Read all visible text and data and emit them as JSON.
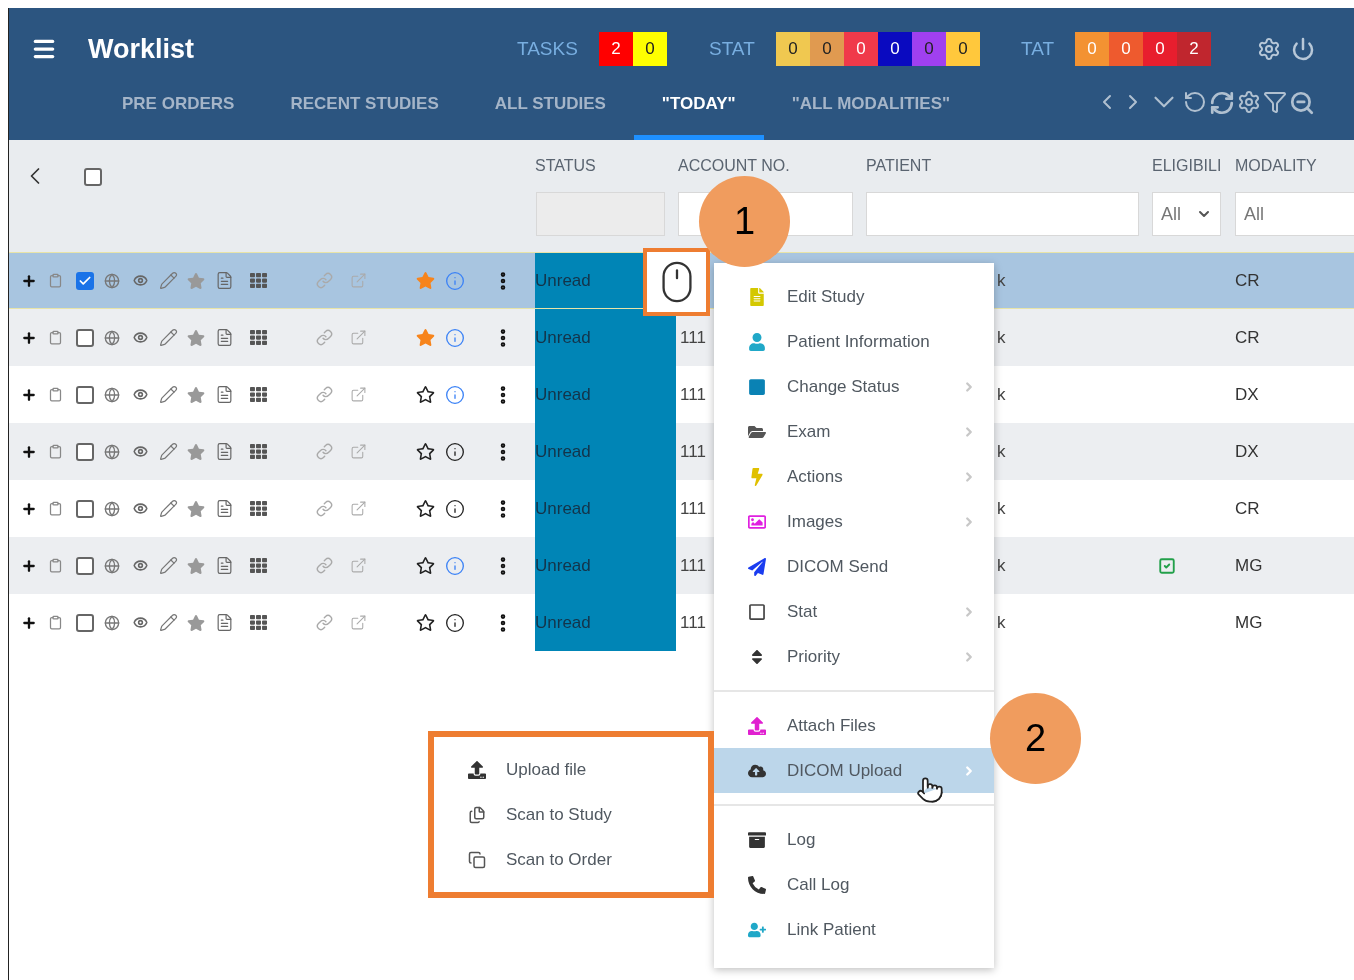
{
  "header": {
    "title": "Worklist",
    "counters": [
      {
        "label": "TASKS",
        "badges": [
          {
            "value": "2",
            "color": "#ff0000",
            "light_text": true
          },
          {
            "value": "0",
            "color": "#ffff00",
            "light_text": false
          }
        ]
      },
      {
        "label": "STAT",
        "badges": [
          {
            "value": "0",
            "color": "#f0c850",
            "light_text": false
          },
          {
            "value": "0",
            "color": "#e09a50",
            "light_text": false
          },
          {
            "value": "0",
            "color": "#f0394a",
            "light_text": true
          },
          {
            "value": "0",
            "color": "#0a0ac0",
            "light_text": true
          },
          {
            "value": "0",
            "color": "#a040f0",
            "light_text": false
          },
          {
            "value": "0",
            "color": "#ffc83c",
            "light_text": false
          }
        ]
      },
      {
        "label": "TAT",
        "badges": [
          {
            "value": "0",
            "color": "#f39232",
            "light_text": true
          },
          {
            "value": "0",
            "color": "#ee5a2e",
            "light_text": true
          },
          {
            "value": "0",
            "color": "#e81e2e",
            "light_text": true
          },
          {
            "value": "2",
            "color": "#c0262e",
            "light_text": true
          }
        ]
      }
    ],
    "tabs": [
      {
        "label": "PRE ORDERS",
        "selected": false
      },
      {
        "label": "RECENT STUDIES",
        "selected": false
      },
      {
        "label": "ALL STUDIES",
        "selected": false
      },
      {
        "label": "\"TODAY\"",
        "selected": true
      },
      {
        "label": "\"ALL MODALITIES\"",
        "selected": false
      }
    ]
  },
  "table": {
    "select_all_checked": false,
    "columns": [
      {
        "label": "STATUS",
        "kind": "readonly"
      },
      {
        "label": "ACCOUNT NO.",
        "kind": "text"
      },
      {
        "label": "PATIENT",
        "kind": "text"
      },
      {
        "label": "ELIGIBILI",
        "kind": "select",
        "value": "All"
      },
      {
        "label": "MODALITY",
        "kind": "combo",
        "placeholder": "All"
      }
    ],
    "rows": [
      {
        "selected": true,
        "checked": true,
        "starred": true,
        "info_active": true,
        "status": "Unread",
        "patient": "k",
        "eligible": false,
        "modality": "CR"
      },
      {
        "selected": false,
        "checked": false,
        "starred": true,
        "info_active": true,
        "status": "Unread",
        "account": "111",
        "patient": "k",
        "eligible": false,
        "modality": "CR"
      },
      {
        "selected": false,
        "checked": false,
        "starred": false,
        "info_active": true,
        "status": "Unread",
        "account": "111",
        "patient": "k",
        "eligible": false,
        "modality": "DX"
      },
      {
        "selected": false,
        "checked": false,
        "starred": false,
        "info_active": false,
        "status": "Unread",
        "account": "111",
        "patient": "k",
        "eligible": false,
        "modality": "DX"
      },
      {
        "selected": false,
        "checked": false,
        "starred": false,
        "info_active": false,
        "status": "Unread",
        "account": "111",
        "patient": "k",
        "eligible": false,
        "modality": "CR"
      },
      {
        "selected": false,
        "checked": false,
        "starred": false,
        "info_active": true,
        "status": "Unread",
        "account": "111",
        "patient": "k",
        "eligible": true,
        "modality": "MG"
      },
      {
        "selected": false,
        "checked": false,
        "starred": false,
        "info_active": false,
        "status": "Unread",
        "account": "111",
        "patient": "k",
        "eligible": false,
        "modality": "MG"
      }
    ]
  },
  "context_menu": {
    "groups": [
      [
        {
          "label": "Edit Study",
          "submenu": false,
          "selected": false
        },
        {
          "label": "Patient Information",
          "submenu": false,
          "selected": false
        },
        {
          "label": "Change Status",
          "submenu": true,
          "selected": false
        },
        {
          "label": "Exam",
          "submenu": true,
          "selected": false
        },
        {
          "label": "Actions",
          "submenu": true,
          "selected": false
        },
        {
          "label": "Images",
          "submenu": true,
          "selected": false
        },
        {
          "label": "DICOM Send",
          "submenu": false,
          "selected": false
        },
        {
          "label": "Stat",
          "submenu": true,
          "selected": false
        },
        {
          "label": "Priority",
          "submenu": true,
          "selected": false
        }
      ],
      [
        {
          "label": "Attach Files",
          "submenu": false,
          "selected": false
        },
        {
          "label": "DICOM Upload",
          "submenu": true,
          "selected": true
        }
      ],
      [
        {
          "label": "Log",
          "submenu": false,
          "selected": false
        },
        {
          "label": "Call Log",
          "submenu": false,
          "selected": false
        },
        {
          "label": "Link Patient",
          "submenu": false,
          "selected": false
        }
      ]
    ]
  },
  "submenu": [
    {
      "label": "Upload file"
    },
    {
      "label": "Scan to Study"
    },
    {
      "label": "Scan to Order"
    }
  ],
  "callouts": [
    {
      "label": "1"
    },
    {
      "label": "2"
    }
  ]
}
